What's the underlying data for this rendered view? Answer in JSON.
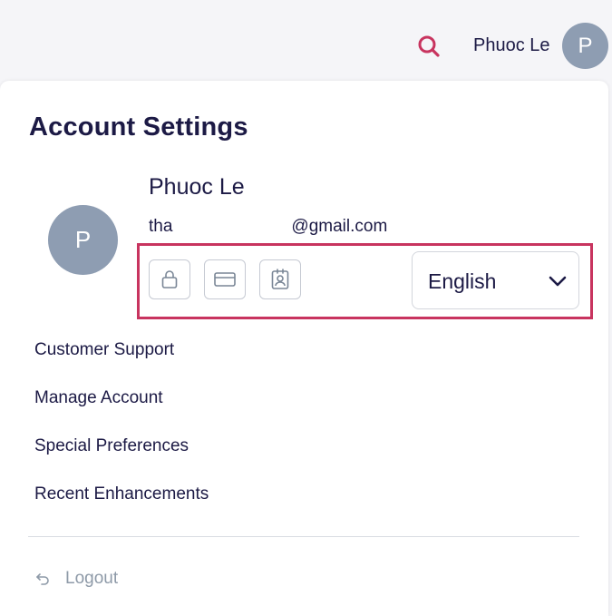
{
  "header": {
    "search_icon": "search-icon",
    "user_name": "Phuoc Le",
    "avatar_initial": "P",
    "accent_color": "#c8345f"
  },
  "page": {
    "title": "Account Settings"
  },
  "profile": {
    "avatar_initial": "P",
    "name": "Phuoc Le",
    "email_prefix": "tha",
    "email_suffix": "@gmail.com"
  },
  "quick_actions": [
    {
      "icon": "lock-icon"
    },
    {
      "icon": "credit-card-icon"
    },
    {
      "icon": "id-badge-icon"
    }
  ],
  "language": {
    "selected": "English"
  },
  "menu": {
    "items": [
      {
        "label": "Customer Support"
      },
      {
        "label": "Manage Account"
      },
      {
        "label": "Special Preferences"
      },
      {
        "label": "Recent Enhancements"
      }
    ]
  },
  "logout": {
    "label": "Logout",
    "icon": "logout-arrow-icon"
  }
}
